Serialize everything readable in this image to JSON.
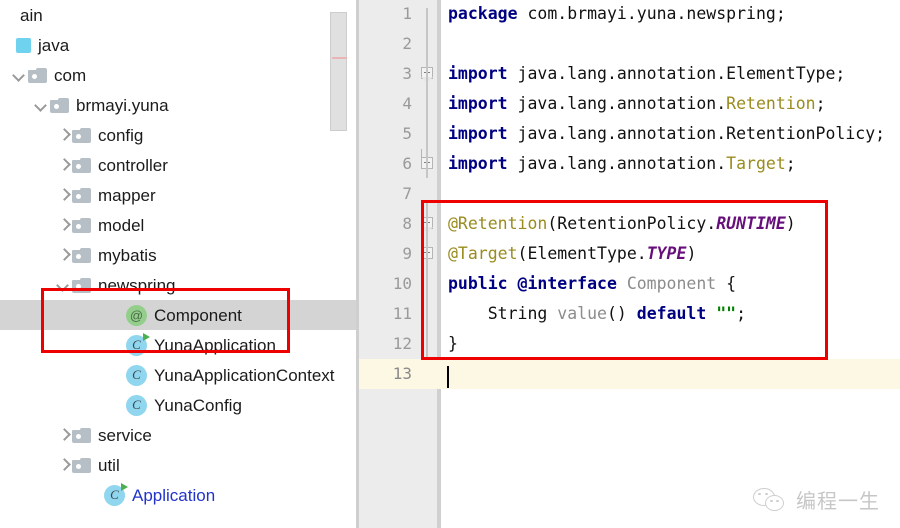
{
  "app": {
    "kind": "java-ide-editor"
  },
  "sidebar": {
    "name": "project-tree",
    "scrollbar": {
      "name": "tree-scrollbar"
    },
    "items": [
      {
        "label": "ain",
        "icon": "none",
        "arrow": "none",
        "indent": 0,
        "selected": false,
        "link": false
      },
      {
        "label": "java",
        "icon": "source-root-icon",
        "arrow": "none",
        "indent": 0,
        "selected": false,
        "link": false
      },
      {
        "label": "com",
        "icon": "folder-icon",
        "arrow": "open",
        "indent": 12,
        "selected": false,
        "link": false
      },
      {
        "label": "brmayi.yuna",
        "icon": "folder-icon",
        "arrow": "open",
        "indent": 34,
        "selected": false,
        "link": false
      },
      {
        "label": "config",
        "icon": "folder-icon",
        "arrow": "closed",
        "indent": 56,
        "selected": false,
        "link": false
      },
      {
        "label": "controller",
        "icon": "folder-icon",
        "arrow": "closed",
        "indent": 56,
        "selected": false,
        "link": false
      },
      {
        "label": "mapper",
        "icon": "folder-icon",
        "arrow": "closed",
        "indent": 56,
        "selected": false,
        "link": false
      },
      {
        "label": "model",
        "icon": "folder-icon",
        "arrow": "closed",
        "indent": 56,
        "selected": false,
        "link": false
      },
      {
        "label": "mybatis",
        "icon": "folder-icon",
        "arrow": "closed",
        "indent": 56,
        "selected": false,
        "link": false
      },
      {
        "label": "newspring",
        "icon": "folder-icon",
        "arrow": "open",
        "indent": 56,
        "selected": false,
        "link": false
      },
      {
        "label": "Component",
        "icon": "annotation-icon",
        "arrow": "none",
        "indent": 110,
        "selected": true,
        "link": false
      },
      {
        "label": "YunaApplication",
        "icon": "class-run-icon",
        "arrow": "none",
        "indent": 110,
        "selected": false,
        "link": false
      },
      {
        "label": "YunaApplicationContext",
        "icon": "class-icon",
        "arrow": "none",
        "indent": 110,
        "selected": false,
        "link": false
      },
      {
        "label": "YunaConfig",
        "icon": "class-icon",
        "arrow": "none",
        "indent": 110,
        "selected": false,
        "link": false
      },
      {
        "label": "service",
        "icon": "folder-icon",
        "arrow": "closed",
        "indent": 56,
        "selected": false,
        "link": false
      },
      {
        "label": "util",
        "icon": "folder-icon",
        "arrow": "closed",
        "indent": 56,
        "selected": false,
        "link": false
      },
      {
        "label": "Application",
        "icon": "class-run-icon",
        "arrow": "none",
        "indent": 88,
        "selected": false,
        "link": true
      }
    ]
  },
  "editor": {
    "name": "code-editor",
    "current_line": 13,
    "lines": [
      {
        "num": "1",
        "fold": "none",
        "tokens": [
          {
            "t": "package ",
            "c": "kw"
          },
          {
            "t": "com.brmayi.yuna.newspring;",
            "c": "plain"
          }
        ]
      },
      {
        "num": "2",
        "fold": "none",
        "tokens": []
      },
      {
        "num": "3",
        "fold": "start",
        "tokens": [
          {
            "t": "import ",
            "c": "kw"
          },
          {
            "t": "java.lang.annotation.ElementType;",
            "c": "plain"
          }
        ]
      },
      {
        "num": "4",
        "fold": "none",
        "tokens": [
          {
            "t": "import ",
            "c": "kw"
          },
          {
            "t": "java.lang.annotation.",
            "c": "plain"
          },
          {
            "t": "Retention",
            "c": "ann"
          },
          {
            "t": ";",
            "c": "plain"
          }
        ]
      },
      {
        "num": "5",
        "fold": "none",
        "tokens": [
          {
            "t": "import ",
            "c": "kw"
          },
          {
            "t": "java.lang.annotation.RetentionPolicy;",
            "c": "plain"
          }
        ]
      },
      {
        "num": "6",
        "fold": "end",
        "tokens": [
          {
            "t": "import ",
            "c": "kw"
          },
          {
            "t": "java.lang.annotation.",
            "c": "plain"
          },
          {
            "t": "Target",
            "c": "ann"
          },
          {
            "t": ";",
            "c": "plain"
          }
        ]
      },
      {
        "num": "7",
        "fold": "none",
        "tokens": []
      },
      {
        "num": "8",
        "fold": "start",
        "tokens": [
          {
            "t": "@Retention",
            "c": "ann"
          },
          {
            "t": "(RetentionPolicy.",
            "c": "plain"
          },
          {
            "t": "RUNTIME",
            "c": "const"
          },
          {
            "t": ")",
            "c": "plain"
          }
        ]
      },
      {
        "num": "9",
        "fold": "end",
        "tokens": [
          {
            "t": "@Target",
            "c": "ann"
          },
          {
            "t": "(ElementType.",
            "c": "plain"
          },
          {
            "t": "TYPE",
            "c": "const"
          },
          {
            "t": ")",
            "c": "plain"
          }
        ]
      },
      {
        "num": "10",
        "fold": "none",
        "tokens": [
          {
            "t": "public @interface ",
            "c": "kw"
          },
          {
            "t": "Component",
            "c": "gray"
          },
          {
            "t": " {",
            "c": "plain"
          }
        ]
      },
      {
        "num": "11",
        "fold": "none",
        "tokens": [
          {
            "t": "    String ",
            "c": "plain"
          },
          {
            "t": "value",
            "c": "gray"
          },
          {
            "t": "() ",
            "c": "plain"
          },
          {
            "t": "default ",
            "c": "kw"
          },
          {
            "t": "\"\"",
            "c": "str"
          },
          {
            "t": ";",
            "c": "plain"
          }
        ]
      },
      {
        "num": "12",
        "fold": "none",
        "tokens": [
          {
            "t": "}",
            "c": "plain"
          }
        ]
      },
      {
        "num": "13",
        "fold": "none",
        "tokens": []
      }
    ]
  },
  "annotations": {
    "tree_highlight_color": "#ee0000",
    "code_highlight_color": "#ee0000"
  },
  "watermark": {
    "text": "编程一生",
    "icon": "wechat-icon"
  }
}
